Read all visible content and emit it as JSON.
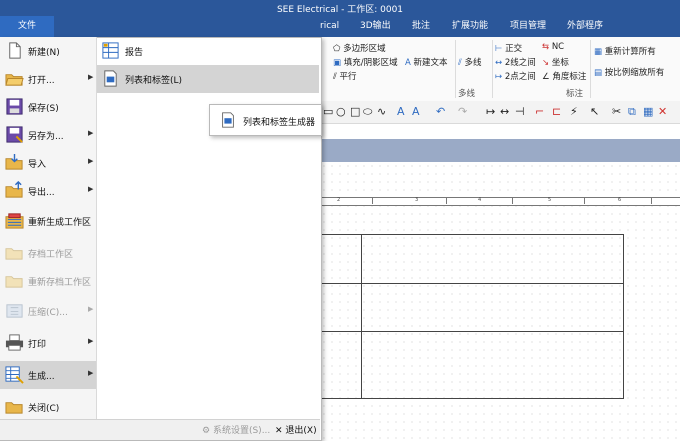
{
  "window": {
    "title": "SEE Electrical - 工作区: 0001"
  },
  "ribbon": {
    "file_tab": "文件",
    "tabs": [
      "rical",
      "3D输出",
      "批注",
      "扩展功能",
      "项目管理",
      "外部程序"
    ],
    "items": {
      "polygon_area": "多边形区域",
      "fill_area": "填充/阴影区域",
      "new_text": "新建文本",
      "parallel": "平行",
      "polyline": "多线",
      "orthogonal": "正交",
      "between_two_lines": "2线之间",
      "between_two_points": "2点之间",
      "nc": "NC",
      "coordinate": "坐标",
      "angle_dimension": "角度标注",
      "recalc_all": "重新计算所有",
      "scale_all": "按比例缩放所有"
    },
    "groups": {
      "polyline": "多线",
      "dimension": "标注"
    }
  },
  "file_menu": {
    "items": [
      {
        "label": "新建(N)",
        "icon": "new-doc-icon",
        "arrow": false,
        "disabled": false
      },
      {
        "label": "打开...",
        "icon": "open-folder-icon",
        "arrow": true,
        "disabled": false
      },
      {
        "label": "保存(S)",
        "icon": "save-icon",
        "arrow": false,
        "disabled": false
      },
      {
        "label": "另存为...",
        "icon": "save-as-icon",
        "arrow": true,
        "disabled": false
      },
      {
        "label": "导入",
        "icon": "import-icon",
        "arrow": true,
        "disabled": false
      },
      {
        "label": "导出...",
        "icon": "export-icon",
        "arrow": true,
        "disabled": false
      },
      {
        "label": "重新生成工作区",
        "icon": "regenerate-icon",
        "arrow": false,
        "disabled": false
      },
      {
        "label": "存档工作区",
        "icon": "archive-icon",
        "arrow": false,
        "disabled": true
      },
      {
        "label": "重新存档工作区",
        "icon": "rearchive-icon",
        "arrow": false,
        "disabled": true
      },
      {
        "label": "压缩(C)...",
        "icon": "compress-icon",
        "arrow": true,
        "disabled": true
      },
      {
        "label": "打印",
        "icon": "print-icon",
        "arrow": true,
        "disabled": false
      },
      {
        "label": "生成...",
        "icon": "generate-icon",
        "arrow": true,
        "disabled": false
      },
      {
        "label": "关闭(C)",
        "icon": "close-folder-icon",
        "arrow": false,
        "disabled": false
      }
    ],
    "submenu": [
      {
        "label": "报告",
        "icon": "report-icon"
      },
      {
        "label": "列表和标签(L)",
        "icon": "list-label-icon"
      }
    ],
    "popup": {
      "label": "列表和标签生成器",
      "icon": "generator-icon"
    },
    "bottom": {
      "settings": "系统设置(S)...",
      "exit": "退出(X)"
    }
  },
  "ruler": {
    "labels": [
      "2",
      "3",
      "4",
      "5",
      "6"
    ]
  }
}
